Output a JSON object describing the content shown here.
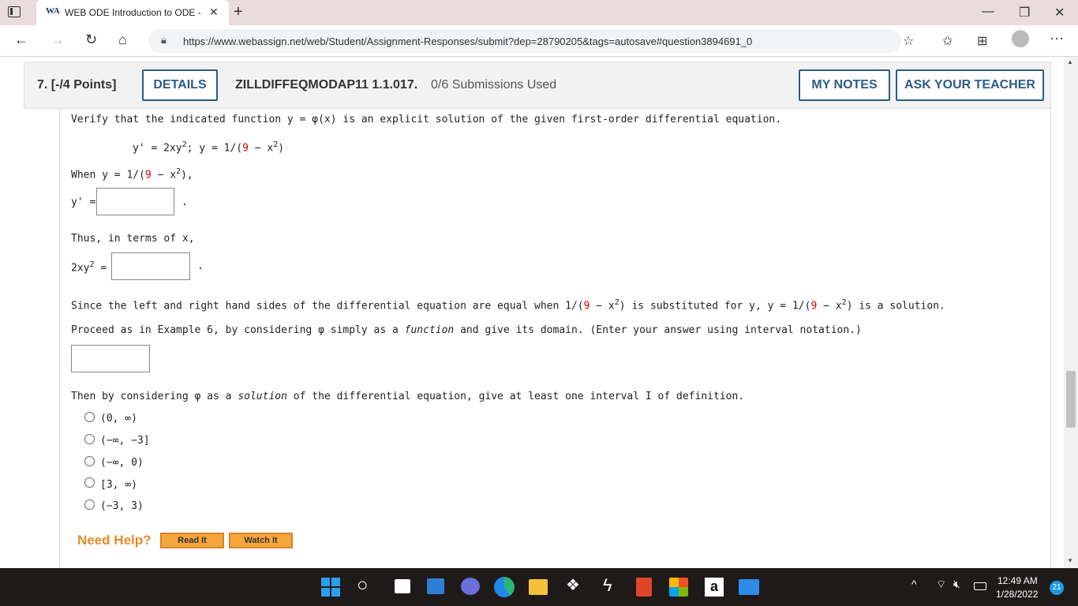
{
  "browser": {
    "tab_title": "WEB ODE Introduction to ODE -",
    "favicon_text": "WA",
    "url": "https://www.webassign.net/web/Student/Assignment-Responses/submit?dep=28790205&tags=autosave#question3894691_0"
  },
  "question": {
    "number": "7.  [-/4 Points]",
    "details_label": "DETAILS",
    "code": "ZILLDIFFEQMODAP11 1.1.017.",
    "submissions": "0/6 Submissions Used",
    "my_notes_label": "MY NOTES",
    "ask_teacher_label": "ASK YOUR TEACHER",
    "intro_a": "Verify that the indicated function y = φ(x) is an explicit solution of the given first-order differential equation.",
    "equation_a": "y' = 2xy",
    "equation_sup": "2",
    "equation_b": ";   y = 1/(",
    "nine": "9",
    "equation_c": " − x",
    "equation_d": ")",
    "when_a": "When y = 1/(",
    "when_b": " − x",
    "when_c": "),",
    "yprime_label": "y' =",
    "period": ".",
    "thus_text": "Thus, in terms of x,",
    "twoxy_label": "2xy",
    "equals": " =",
    "since_a": "Since the left and right hand sides of the differential equation are equal when 1/(",
    "since_b": " − x",
    "since_c": ") is substituted for y, y = 1/(",
    "since_d": ") is a solution.",
    "proceed_a": "Proceed as in Example 6, by considering φ simply as a ",
    "proceed_fn": "function",
    "proceed_b": " and give its domain. (Enter your answer using interval notation.)",
    "then_a": "Then by considering φ as a ",
    "then_sol": "solution",
    "then_b": " of the differential equation, give at least one interval I of definition.",
    "options": [
      "(0, ∞)",
      "(−∞, −3]",
      "(−∞, 0)",
      "[3, ∞)",
      "(−3, 3)"
    ],
    "need_help": "Need Help?",
    "read_it": "Read It",
    "watch_it": "Watch It"
  },
  "taskbar": {
    "time": "12:49 AM",
    "date": "1/28/2022",
    "notifications": "21"
  },
  "colors": {
    "accent": "#2b5c89",
    "help_orange": "#e8892b",
    "red_number": "#dd0000"
  }
}
